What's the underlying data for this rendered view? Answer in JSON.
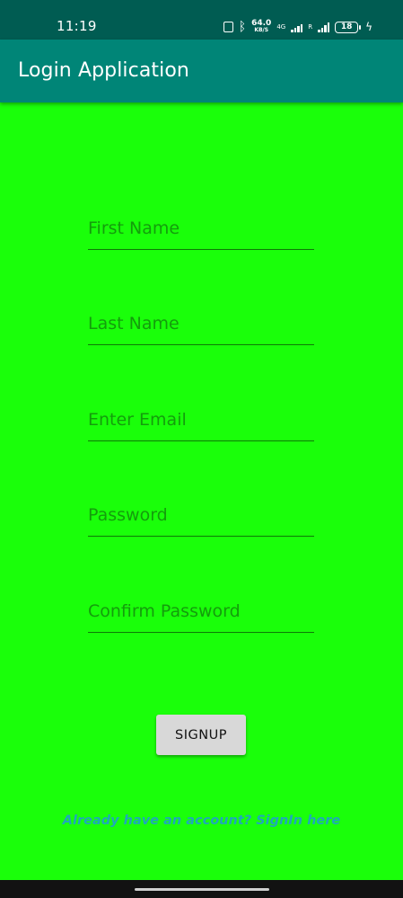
{
  "status_bar": {
    "time": "11:19",
    "speed_value": "64.0",
    "speed_unit": "KB/S",
    "network": "4G",
    "roaming": "R",
    "battery": "18"
  },
  "app_bar": {
    "title": "Login Application"
  },
  "form": {
    "first_name_placeholder": "First Name",
    "last_name_placeholder": "Last Name",
    "email_placeholder": "Enter Email",
    "password_placeholder": "Password",
    "confirm_password_placeholder": "Confirm Password",
    "signup_label": "SIGNUP",
    "signin_link": "Already have an account? SignIn here"
  },
  "colors": {
    "background": "#1aff0a",
    "status_bar": "#005c52",
    "app_bar": "#008577",
    "link": "#1fa9b9"
  },
  "icons": [
    "vibrate-icon",
    "bluetooth-icon",
    "signal-icon",
    "battery-icon",
    "charging-icon"
  ]
}
